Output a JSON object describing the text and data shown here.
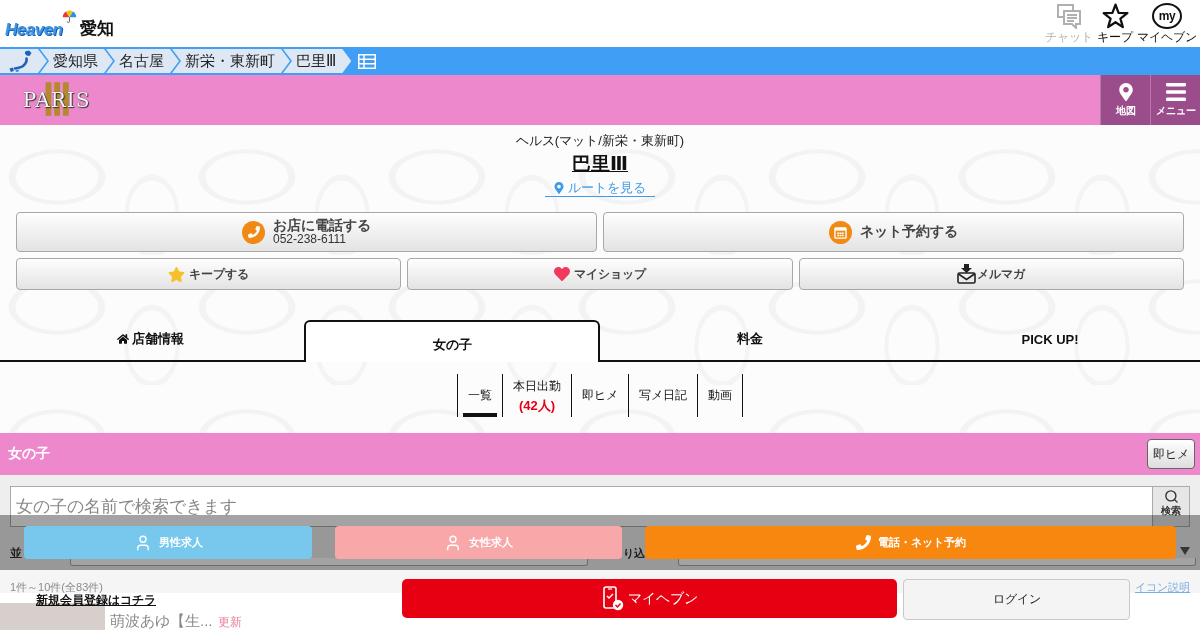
{
  "header": {
    "logo": "Heaven",
    "region": "愛知",
    "actions": [
      {
        "kind": "chat",
        "label": "チャット",
        "disabled": true
      },
      {
        "kind": "keep",
        "label": "キープ",
        "disabled": false
      },
      {
        "kind": "mypage",
        "label": "マイヘブン",
        "badge": "my",
        "disabled": false
      }
    ]
  },
  "breadcrumbs": [
    "愛知県",
    "名古屋",
    "新栄・東新町",
    "巴里Ⅲ"
  ],
  "shop_bar": {
    "logo": {
      "name": "PARIS",
      "numeral": "Ⅲ"
    },
    "buttons": [
      {
        "kind": "map",
        "label": "地図"
      },
      {
        "kind": "menu",
        "label": "メニュー"
      }
    ]
  },
  "shop": {
    "category": "ヘルス(マット/新栄・東新町)",
    "name": "巴里Ⅲ",
    "route_link": "ルートを見る",
    "main_actions": [
      {
        "kind": "call",
        "label": "お店に電話する",
        "phone": "052-238-6111"
      },
      {
        "kind": "reserve",
        "label": "ネット予約する"
      }
    ],
    "sub_actions": [
      {
        "kind": "keep",
        "label": "キープする"
      },
      {
        "kind": "myshop",
        "label": "マイショップ"
      },
      {
        "kind": "mailmag",
        "label": "メルマガ"
      }
    ]
  },
  "tabs": [
    {
      "kind": "home",
      "label": "店舗情報",
      "selected": false
    },
    {
      "kind": "text",
      "label": "女の子",
      "selected": true
    },
    {
      "kind": "text",
      "label": "料金",
      "selected": false
    },
    {
      "kind": "text",
      "label": "PICK UP!",
      "selected": false
    }
  ],
  "subtabs": [
    {
      "label": "一覧",
      "selected": true
    },
    {
      "label": "本日出勤",
      "count": "(42人)",
      "selected": false
    },
    {
      "label": "即ヒメ",
      "selected": false
    },
    {
      "label": "写メ日記",
      "selected": false
    },
    {
      "label": "動画",
      "selected": false
    }
  ],
  "girls": {
    "title": "女の子",
    "quick_button": "即ヒメ",
    "search": {
      "placeholder": "女の子の名前で検索できます",
      "button": "検索"
    },
    "sort_label": "並",
    "filter_label": "り込",
    "result_count": "1件～10件(全83件)",
    "icon_help": "イコン説明",
    "list": [
      {
        "name": "萌波あゆ【生...",
        "badge": "更新"
      }
    ]
  },
  "action_bar": [
    {
      "kind": "male",
      "label": "男性求人"
    },
    {
      "kind": "female",
      "label": "女性求人"
    },
    {
      "kind": "call",
      "label": "電話・ネット予約"
    }
  ],
  "footer": {
    "register_link": "新規会員登録はコチラ",
    "mypage_button": "マイヘブン",
    "login_button": "ログイン"
  }
}
